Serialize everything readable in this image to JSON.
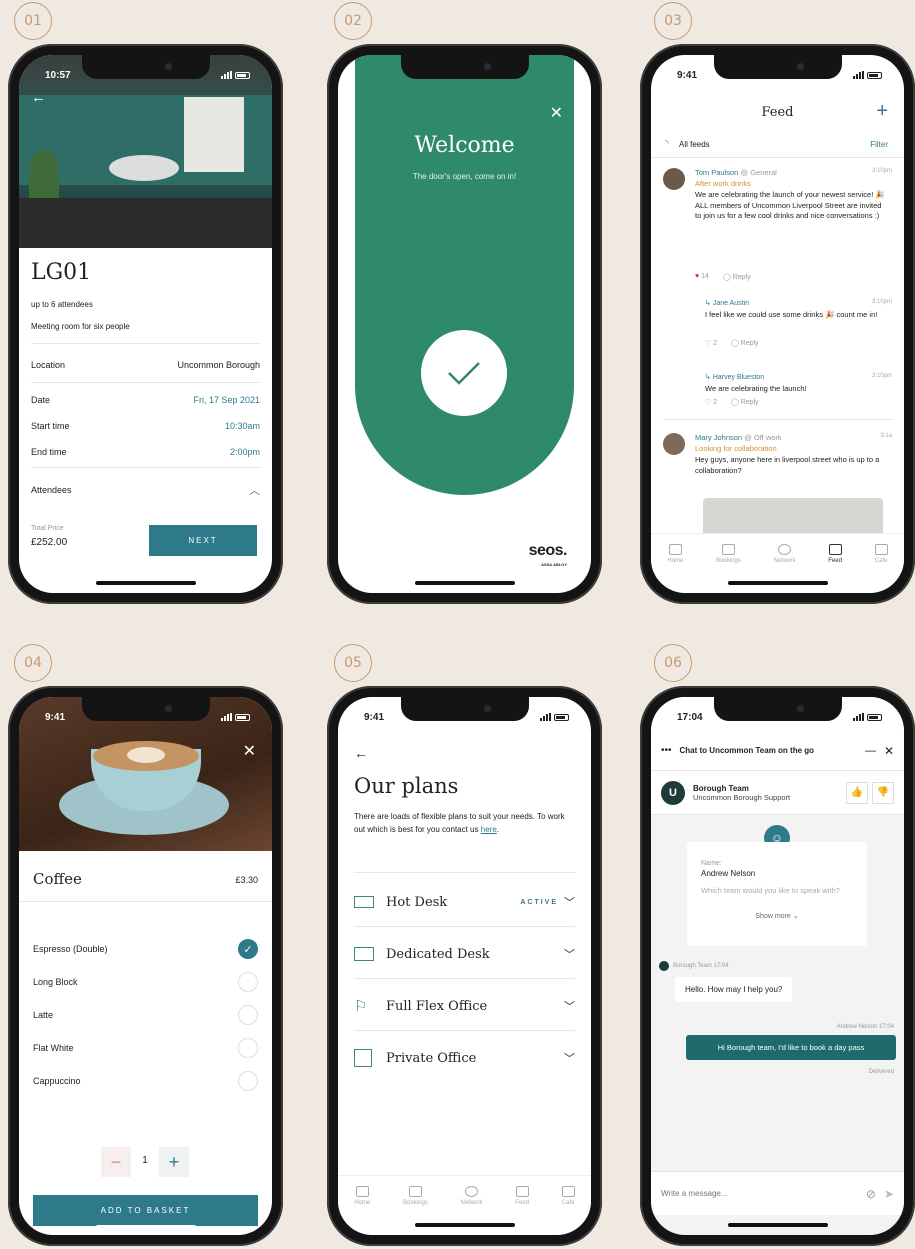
{
  "badges": [
    "01",
    "02",
    "03",
    "04",
    "05",
    "06"
  ],
  "screen1": {
    "status_time": "10:57",
    "room_title": "LG01",
    "attendees_cap": "up to 6 attendees",
    "description": "Meeting room for six people",
    "location_label": "Location",
    "location_value": "Uncommon Borough",
    "date_label": "Date",
    "date_value": "Fri, 17 Sep 2021",
    "start_label": "Start time",
    "start_value": "10:30am",
    "end_label": "End time",
    "end_value": "2:00pm",
    "attendees_label": "Attendees",
    "total_label": "Total Price",
    "total_value": "£252.00",
    "next_label": "NEXT"
  },
  "screen2": {
    "title": "Welcome",
    "subtitle": "The door's open, come on in!",
    "brand": "seos.",
    "brand_sub": "ASSA ABLOY"
  },
  "screen3": {
    "status_time": "9:41",
    "title": "Feed",
    "all_feeds": "All feeds",
    "filter": "Filter",
    "posts": [
      {
        "author": "Tom Paulson",
        "channel": "@ General",
        "time": "3:10pm",
        "subject": "After work drinks",
        "body": "We are celebrating the launch of your newest service! 🎉\nALL members of Uncommon Liverpool Street are invited to join us for a few cool drinks and nice conversations :)",
        "likes": "14",
        "reply": "Reply"
      },
      {
        "author": "Jane Austin",
        "time": "3:10pm",
        "body": "I feel like we could use some drinks 🎉 count me in!",
        "likes": "2",
        "reply": "Reply"
      },
      {
        "author": "Harvey Blueston",
        "time": "3:10pm",
        "body": "We are celebrating the launch!",
        "likes": "2",
        "reply": "Reply"
      },
      {
        "author": "Mary Johnson",
        "channel": "@ Off work",
        "time": "3:1a",
        "subject": "Looking for collaboration",
        "body": "Hey guys, anyone here in liverpool street who is up to a collaboration?"
      }
    ],
    "tabs": [
      "Home",
      "Bookings",
      "Network",
      "Feed",
      "Cafe"
    ]
  },
  "screen4": {
    "status_time": "9:41",
    "title": "Coffee",
    "price": "£3.30",
    "options": [
      "Espresso (Double)",
      "Long Block",
      "Latte",
      "Flat White",
      "Cappuccino"
    ],
    "quantity": "1",
    "add_label": "ADD TO BASKET"
  },
  "screen5": {
    "status_time": "9:41",
    "title": "Our plans",
    "intro": "There are loads of flexible plans to suit your needs. To work out which is best for you contact us",
    "intro_link": "here",
    "plans": [
      {
        "name": "Hot Desk",
        "badge": "ACTIVE"
      },
      {
        "name": "Dedicated Desk",
        "badge": ""
      },
      {
        "name": "Full Flex Office",
        "badge": ""
      },
      {
        "name": "Private Office",
        "badge": ""
      }
    ],
    "tabs": [
      "Home",
      "Bookings",
      "Network",
      "Feed",
      "Cafe"
    ]
  },
  "screen6": {
    "status_time": "17:04",
    "header": "Chat to Uncommon Team on the go",
    "team_name": "Borough Team",
    "team_sub": "Uncommon Borough Support",
    "name_label": "Name:",
    "name_value": "Andrew Nelson",
    "question": "Which team would you like to speak with?",
    "show_more": "Show more ⌄",
    "bot_meta": "Borough Team 17:04",
    "bot_msg": "Hello. How may I help you?",
    "user_meta": "Andrew Nelson 17:04",
    "user_msg": "Hi Borough team, I'd like to book a day pass",
    "delivered": "Delivered",
    "input_placeholder": "Write a message..."
  },
  "colors": {
    "teal": "#2e7a8a",
    "green": "#2f8a6a",
    "gold": "#c79a72",
    "beige": "#efe9e1"
  }
}
